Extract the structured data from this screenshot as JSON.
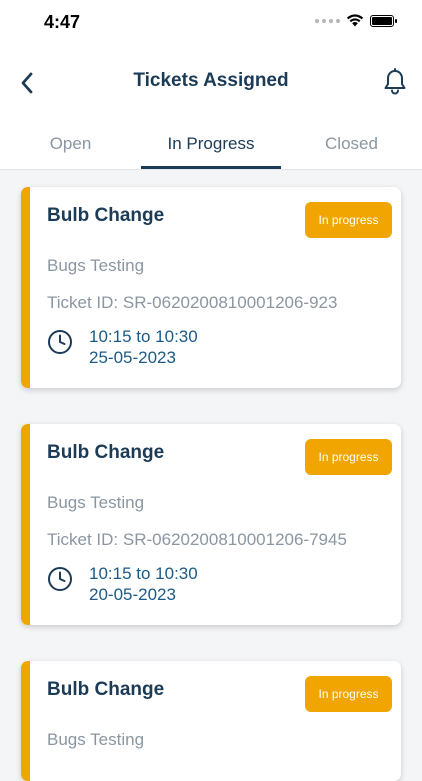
{
  "status_bar": {
    "time": "4:47"
  },
  "header": {
    "title": "Tickets Assigned"
  },
  "tabs": [
    {
      "label": "Open",
      "active": false
    },
    {
      "label": "In Progress",
      "active": true
    },
    {
      "label": "Closed",
      "active": false
    }
  ],
  "colors": {
    "primary": "#1c3b57",
    "accent": "#f0a500",
    "muted": "#8b96a1",
    "time_text": "#1c5a86"
  },
  "tickets": [
    {
      "title": "Bulb Change",
      "status": "In progress",
      "category": "Bugs Testing",
      "ticket_id": "Ticket ID: SR-0620200810001206-923",
      "time_range": "10:15 to 10:30",
      "date": "25-05-2023"
    },
    {
      "title": "Bulb Change",
      "status": "In progress",
      "category": "Bugs Testing",
      "ticket_id": "Ticket ID: SR-0620200810001206-7945",
      "time_range": "10:15 to 10:30",
      "date": "20-05-2023"
    },
    {
      "title": "Bulb Change",
      "status": "In progress",
      "category": "Bugs Testing"
    }
  ]
}
